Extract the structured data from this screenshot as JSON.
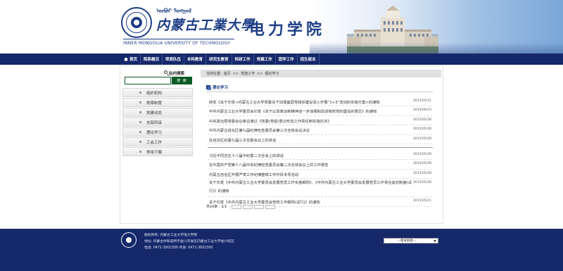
{
  "header": {
    "mongolian_text": "ᠥᠪᠦᠷ ᠮᠣᠩᠭᠣᠯ",
    "university_cn": "内蒙古工業大學",
    "university_en": "INNER MONGOLIA UNIVERSITY OF TECHNOLOGY",
    "site_name": "电力学院"
  },
  "nav": {
    "items": [
      "首页",
      "院系概况",
      "师资队伍",
      "本科教育",
      "研究生教育",
      "科研工作",
      "党建工作",
      "团学工作",
      "招生就业"
    ]
  },
  "sidebar": {
    "search_title": "站内搜索",
    "search_placeholder": "",
    "search_button": "搜 索",
    "menu": [
      "组织机构",
      "规章制度",
      "党建动态",
      "支部风采",
      "理论学习",
      "工会工作",
      "常用下载"
    ]
  },
  "breadcrumb": {
    "prefix": "当前位置:",
    "items": [
      "首页",
      "党建工作",
      "理论学习"
    ],
    "separator": ">>"
  },
  "section": {
    "title": "理论学习"
  },
  "articles_group1": [
    {
      "title": "转发《关于印发<内蒙古工业大学党委关于加强基层党组织建设深入开展“1+3”活动的实施方案>的通知",
      "date": "2015/05/21"
    },
    {
      "title": "中共内蒙古工业大学委员会印发《关于以改革创新精神进一步加强和改进我校党的建设的意见》的通知",
      "date": "2014/06/23"
    },
    {
      "title": "中央政治局常委会议审议通过《党委(党组)意识形态工作责任制实施办法》",
      "date": "2015/05/28"
    },
    {
      "title": "中共内蒙古自治区第九届纪律检查委员会第三次全体会议决议",
      "date": "2015/05/28"
    },
    {
      "title": "在自治区纪委九届三次全委会议上的讲话",
      "date": "2015/05/28"
    }
  ],
  "articles_group2": [
    {
      "title": "习近平同志在十八届中纪委二次全会上的讲话",
      "date": "2015/05/28"
    },
    {
      "title": "在中国共产党第十八届中央纪律检查委员会第二次全体会议上的工作报告",
      "date": "2015/05/28"
    },
    {
      "title": "内蒙古自治区开展严肃工作纪律整顿工作作风专项活动",
      "date": "2015/05/28"
    },
    {
      "title": "关于印发《中共内蒙古工业大学委员会发展党员工作实施细则》、《中共内蒙古工业大学委员会发展党员工作责任追究制度(试行)》的通知",
      "date": "2015/05/28"
    },
    {
      "title": "关于印发《中共内蒙古工业大学委员会党校工作细则(试行)》的通知",
      "date": "2015/05/21"
    }
  ],
  "pager": {
    "total": "共10条",
    "page": "1/1"
  },
  "footer": {
    "line1": "版权所有: 内蒙古工业大学电力学院",
    "line2": "地址: 内蒙古呼和浩特市金川开发区内蒙古工业大学金川校区",
    "line3": "电话: 0471-3602300  传真: 0471-3602300",
    "select_label": "---相关链接---"
  },
  "colors": {
    "nav_bg": "#14286a",
    "brand_blue": "#1d3e86",
    "search_green": "#0c5a26"
  }
}
